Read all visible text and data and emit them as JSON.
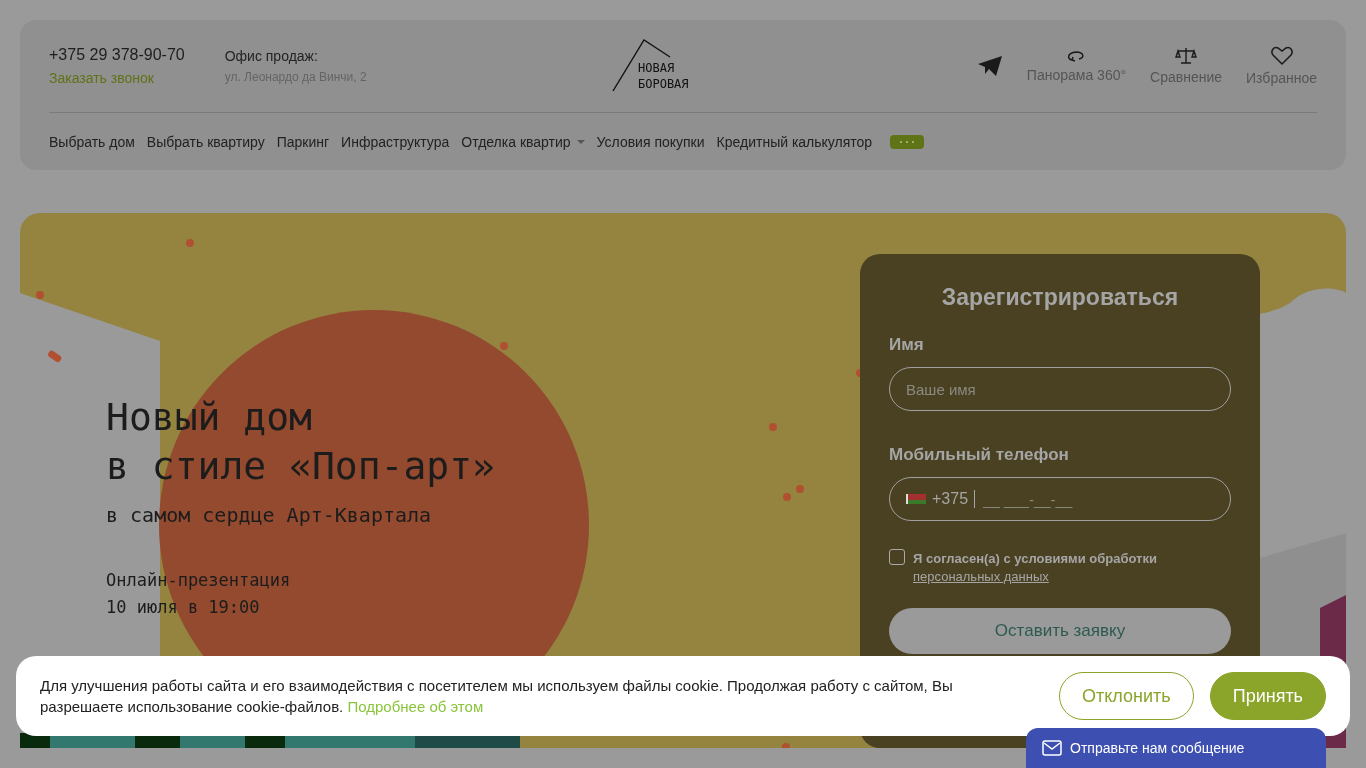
{
  "header": {
    "phone": "+375 29 378-90-70",
    "callback_link": "Заказать звонок",
    "office_label": "Офис продаж:",
    "office_address": "ул. Леонардо да Винчи, 2",
    "logo_lines": [
      "НОВАЯ",
      "БОРОВАЯ"
    ],
    "actions": [
      {
        "kind": "telegram"
      },
      {
        "kind": "panorama",
        "label": "Панорама 360°"
      },
      {
        "kind": "compare",
        "label": "Сравнение"
      },
      {
        "kind": "favorites",
        "label": "Избранное"
      }
    ]
  },
  "nav": [
    {
      "label": "Выбрать дом",
      "dropdown": false
    },
    {
      "label": "Выбрать квартиру",
      "dropdown": false
    },
    {
      "label": "Паркинг",
      "dropdown": false
    },
    {
      "label": "Инфраструктура",
      "dropdown": false
    },
    {
      "label": "Отделка квартир",
      "dropdown": true
    },
    {
      "label": "Условия покупки",
      "dropdown": false
    },
    {
      "label": "Кредитный калькулятор",
      "dropdown": false
    }
  ],
  "hero": {
    "kind": "picture",
    "title_lines": [
      "Новый дом",
      "в стиле «Поп-арт»"
    ],
    "subtitle": "в самом сердце Арт-Квартала",
    "event_lines": [
      "Онлайн-презентация",
      "10 июля в 19:00"
    ]
  },
  "form": {
    "title": "Зарегистрироваться",
    "fields": [
      {
        "kind": "text",
        "label": "Имя",
        "placeholder": "Ваше имя"
      },
      {
        "kind": "phone",
        "label": "Мобильный телефон",
        "country_code": "+375",
        "placeholder": "__ ___-__-__"
      }
    ],
    "consent": {
      "checked": false,
      "text": "Я согласен(а) с условиями обработки",
      "link": "персональных данных"
    },
    "submit": "Оставить заявку"
  },
  "cookie": {
    "text": "Для улучшения работы сайта и его взаимодействия с посетителем мы используем файлы cookie. Продолжая работу с сайтом, Вы разрешаете использование cookie-файлов.",
    "link": "Подробнее об этом",
    "buttons": [
      {
        "kind": "outline",
        "label": "Отклонить"
      },
      {
        "kind": "filled",
        "label": "Принять"
      }
    ]
  },
  "chat": {
    "label": "Отправьте нам сообщение"
  }
}
